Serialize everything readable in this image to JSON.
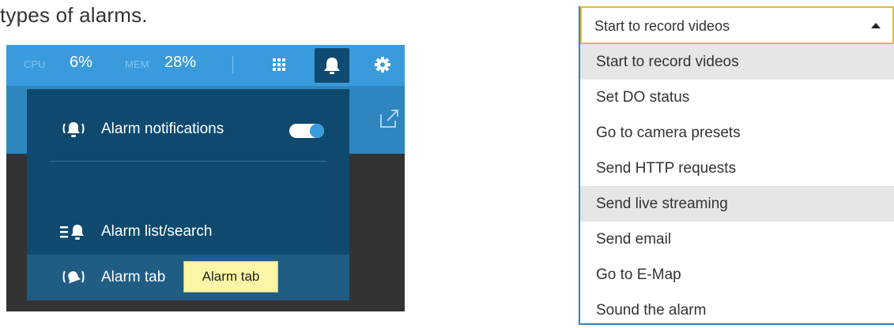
{
  "intro_text": "types of alarms.",
  "topbar": {
    "cpu_label": "CPU",
    "cpu_value": "6%",
    "mem_label": "MEM",
    "mem_value": "28%",
    "icons": [
      "grid-icon",
      "bell-icon",
      "gear-icon"
    ]
  },
  "alarm_menu": {
    "items": [
      {
        "label": "Alarm notifications",
        "icon": "alarm-bell-ringing-icon",
        "toggle_on": true
      },
      {
        "label": "Alarm list/search",
        "icon": "alarm-list-icon"
      },
      {
        "label": "Alarm tab",
        "icon": "alarm-tab-icon",
        "hovered": true
      }
    ],
    "tooltip": "Alarm tab"
  },
  "action_select": {
    "selected": "Start to record videos",
    "options": [
      "Start to record videos",
      "Set DO status",
      "Go to camera presets",
      "Send HTTP requests",
      "Send live streaming",
      "Send email",
      "Go to E-Map",
      "Sound the alarm"
    ]
  },
  "colors": {
    "topbar": "#3a9bdc",
    "menu": "#0f4a6e",
    "select_border": "#e2b93b",
    "tooltip": "#fbf7a6"
  }
}
